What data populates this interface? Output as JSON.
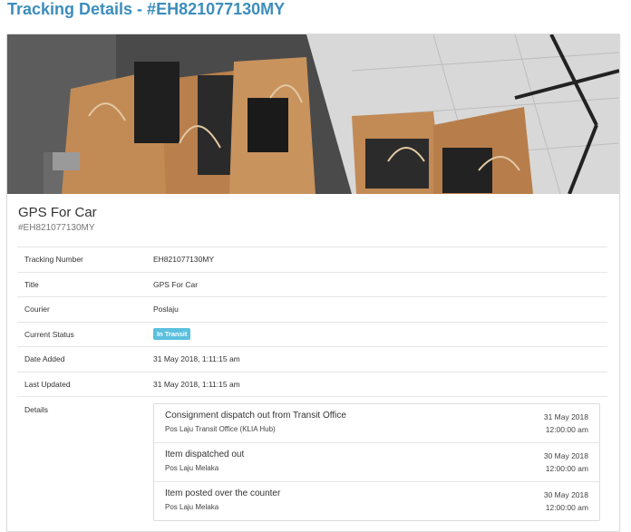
{
  "page": {
    "title": "Tracking Details - #EH821077130MY"
  },
  "product": {
    "title": "GPS For Car",
    "subtitle": "#EH821077130MY"
  },
  "info": {
    "tracking_number_label": "Tracking Number",
    "tracking_number": "EH821077130MY",
    "title_label": "Title",
    "title": "GPS For Car",
    "courier_label": "Courier",
    "courier": "Poslaju",
    "status_label": "Current Status",
    "status": "In Transit",
    "status_color": "#5bc0de",
    "date_added_label": "Date Added",
    "date_added": "31 May 2018, 1:11:15 am",
    "last_updated_label": "Last Updated",
    "last_updated": "31 May 2018, 1:11:15 am",
    "details_label": "Details"
  },
  "events": [
    {
      "title": "Consignment dispatch out from Transit Office",
      "location": "Pos Laju Transit Office (KLIA Hub)",
      "date": "31 May 2018",
      "time": "12:00:00 am"
    },
    {
      "title": "Item dispatched out",
      "location": "Pos Laju Melaka",
      "date": "30 May 2018",
      "time": "12:00:00 am"
    },
    {
      "title": "Item posted over the counter",
      "location": "Pos Laju Melaka",
      "date": "30 May 2018",
      "time": "12:00:00 am"
    }
  ],
  "colors": {
    "accent": "#3c8dbc"
  }
}
